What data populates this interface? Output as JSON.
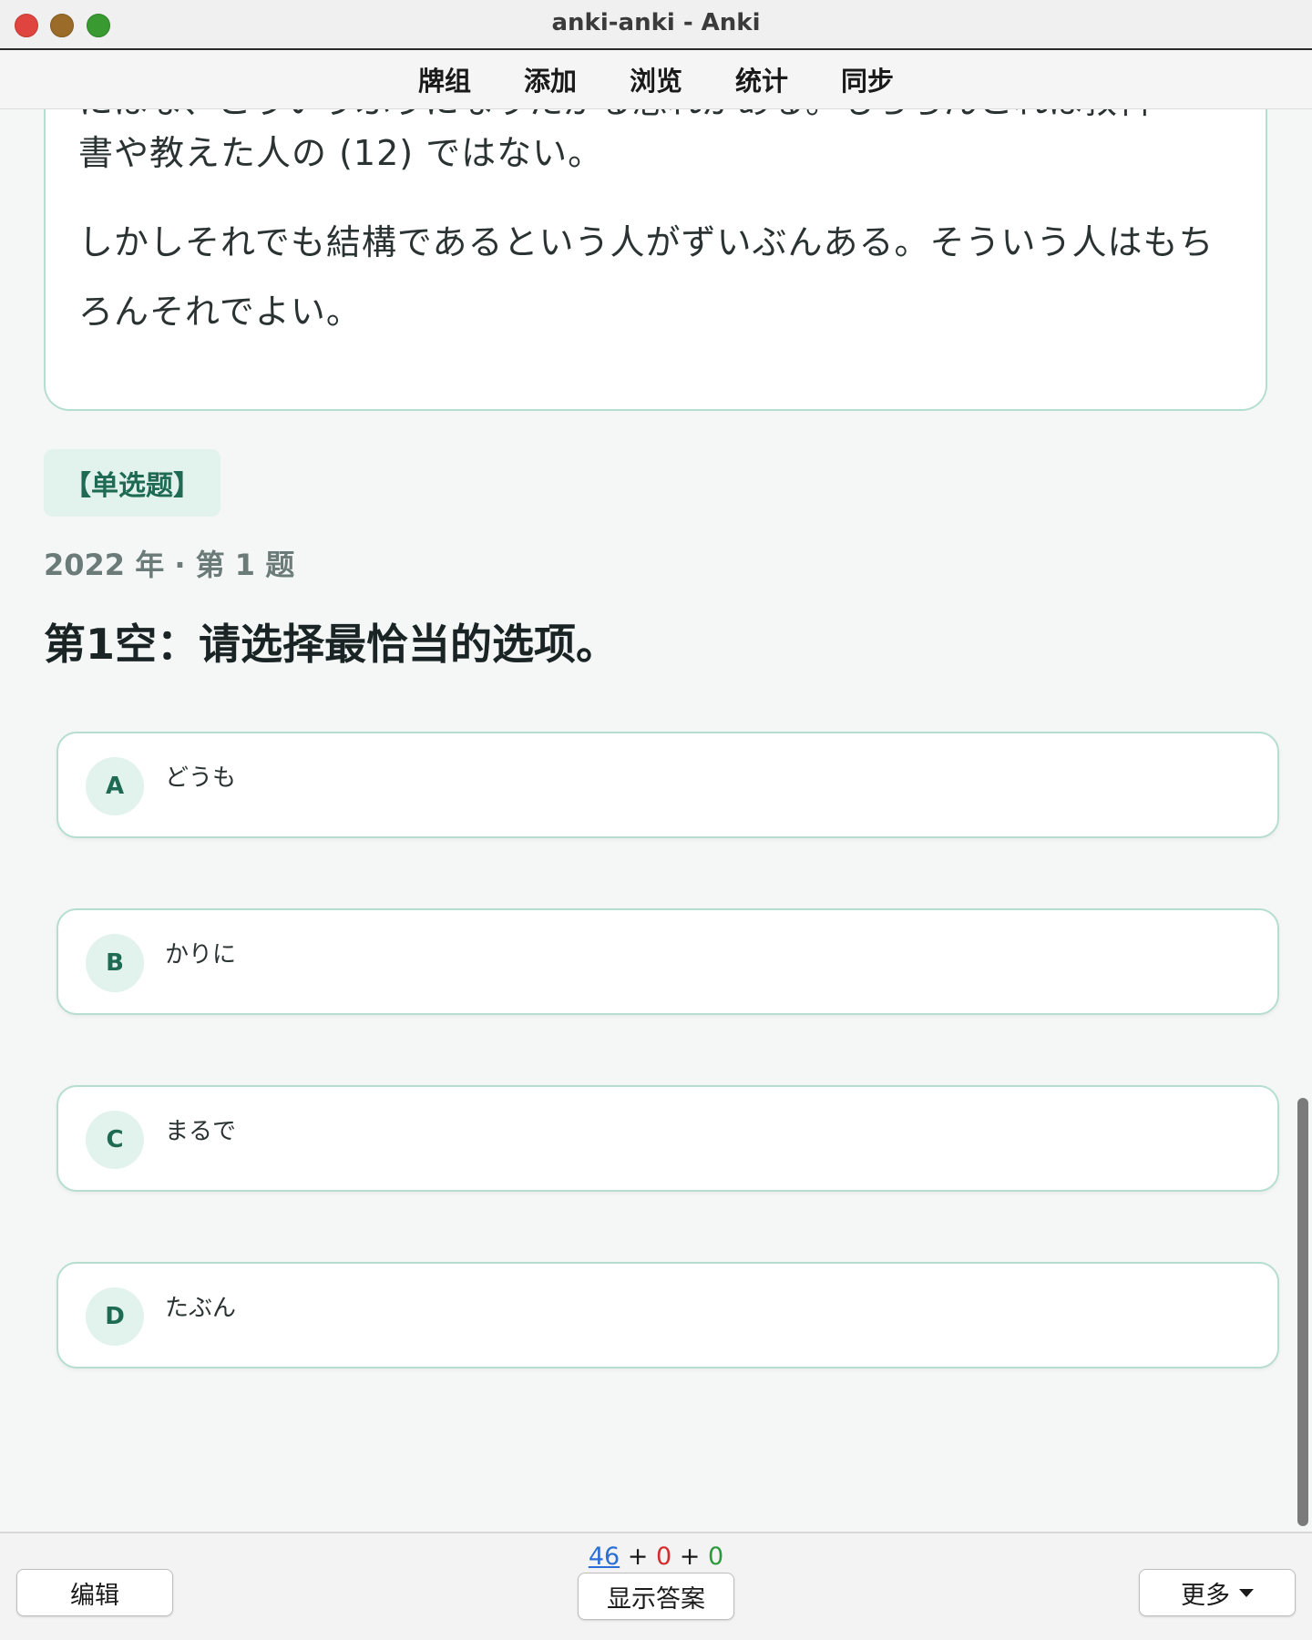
{
  "window": {
    "title": "anki-anki - Anki"
  },
  "menu": [
    {
      "label": "牌组"
    },
    {
      "label": "添加"
    },
    {
      "label": "浏览"
    },
    {
      "label": "统计"
    },
    {
      "label": "同步"
    }
  ],
  "passage": {
    "cut_line": "にはな、こういうふうになりたがる恐れがある。もちろんこれは教科",
    "para1": "書や教えた人の (12) ではない。",
    "para2": "しかしそれでも結構であるという人がずいぶんある。そういう人はもちろんそれでよい。"
  },
  "question": {
    "type_tag": "【单选题】",
    "meta": "2022 年 · 第 1 题",
    "prompt": "第1空：请选择最恰当的选项。"
  },
  "options": [
    {
      "letter": "A",
      "text": "どうも"
    },
    {
      "letter": "B",
      "text": "かりに"
    },
    {
      "letter": "C",
      "text": "まるで"
    },
    {
      "letter": "D",
      "text": "たぶん"
    }
  ],
  "footer": {
    "count_new": "46",
    "count_learn": "0",
    "count_review": "0",
    "plus": "+",
    "edit_label": "编辑",
    "show_answer_label": "显示答案",
    "more_label": "更多"
  },
  "colors": {
    "accent": "#1e6a52",
    "accent_bg": "#e2f2ec",
    "border": "#b6ddd1",
    "new": "#2b6fd6",
    "learn": "#d62b2b",
    "review": "#2a9a3a"
  }
}
